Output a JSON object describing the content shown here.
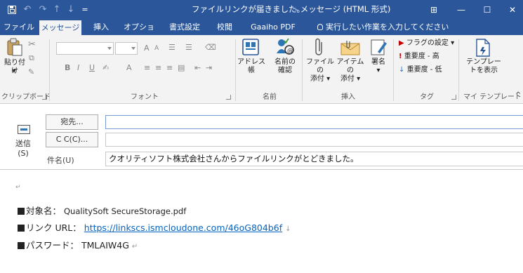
{
  "window": {
    "title": "ファイルリンクが届きました。",
    "subtitle": "-  メッセージ (HTML 形式)",
    "controls": {
      "restore": "⊞",
      "minimize": "—",
      "maximize": "☐",
      "close": "✕"
    }
  },
  "quick_access": {
    "undo": "↶",
    "redo": "↷",
    "up": "↑",
    "down": "↓",
    "more": "="
  },
  "tabs": [
    {
      "label": "ファイル"
    },
    {
      "label": "メッセージ"
    },
    {
      "label": "挿入"
    },
    {
      "label": "オプション"
    },
    {
      "label": "書式設定"
    },
    {
      "label": "校閲"
    },
    {
      "label": "Gaaiho PDF"
    }
  ],
  "tell_me": "実行したい作業を入力してください",
  "ribbon": {
    "clipboard": {
      "paste": "貼り付け",
      "group": "クリップボード"
    },
    "font": {
      "bold": "B",
      "italic": "I",
      "underline": "U",
      "grow": "A",
      "shrink": "A",
      "font_color": "A",
      "group": "フォント"
    },
    "names": {
      "address_book": "アドレス帳",
      "check_names_1": "名前の",
      "check_names_2": "確認",
      "group": "名前"
    },
    "include": {
      "attach_file_1": "ファイルの",
      "attach_file_2": "添付 ▾",
      "attach_item_1": "アイテムの",
      "attach_item_2": "添付 ▾",
      "signature": "署名",
      "signature_dd": "▾",
      "group": "挿入"
    },
    "tags": {
      "follow_up": "フラグの設定 ▾",
      "high_importance": "重要度 - 高",
      "low_importance": "重要度 - 低",
      "group": "タグ"
    },
    "templates": {
      "view_1": "テンプレー",
      "view_2": "トを表示",
      "group": "マイ テンプレート"
    }
  },
  "header": {
    "send_label": "送信",
    "send_key": "(S)",
    "to_button": "宛先...",
    "cc_button": "C C(C)...",
    "to_value": "",
    "cc_value": "",
    "subject_label": "件名(U)",
    "subject_value": "クオリティソフト株式会社さんからファイルリンクがとどきました。"
  },
  "body": {
    "para_mark": "↵",
    "target_label": "対象名：",
    "target_value": "QualitySoft SecureStorage.pdf",
    "link_label": "リンク URL：",
    "link_value": "https://linkscs.ismcloudone.com/46oG804b6f",
    "link_return": "↓",
    "password_label": "パスワード：",
    "password_value": "TMLAIW4G",
    "password_return": "↵"
  },
  "colors": {
    "accent": "#2b579a",
    "ribbon": "#f3f3f3",
    "link": "#0563c1"
  }
}
